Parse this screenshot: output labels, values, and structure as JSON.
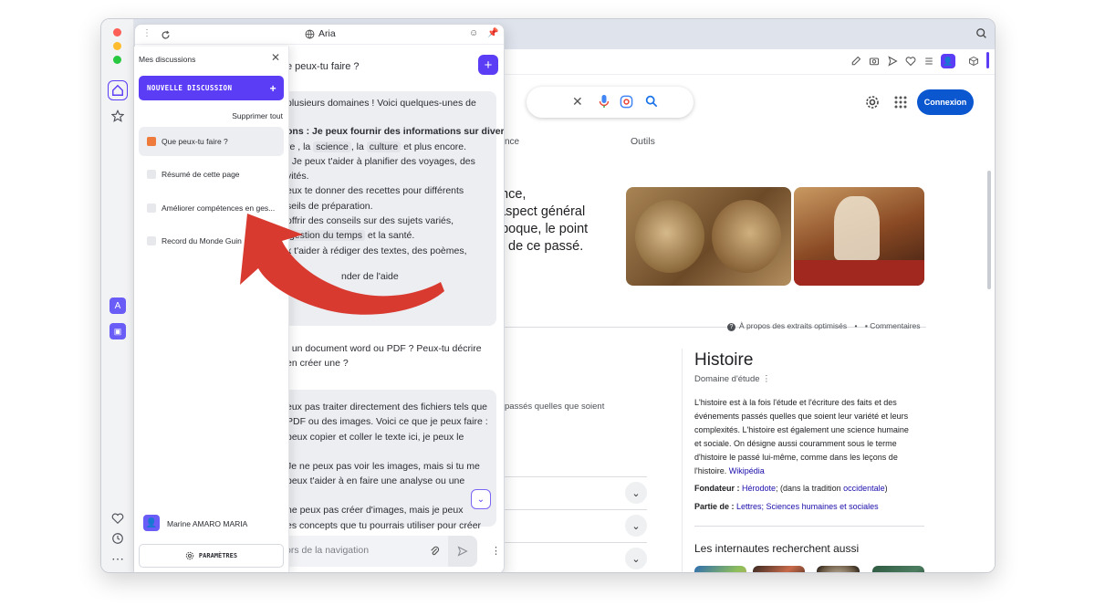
{
  "aria": {
    "title": "Aria",
    "question1": "e peux-tu faire ?",
    "answer1": {
      "lines": [
        "plusieurs domaines ! Voici quelques-unes de",
        "",
        "ons : Je peux fournir des informations sur divers",
        "re",
        ", la",
        "science",
        ", la",
        "culture",
        "et plus encore.",
        ": Je peux t'aider à planifier des voyages, des",
        "vités.",
        "eux te donner des recettes pour différents",
        "seils de préparation.",
        "offrir des conseils sur des sujets variés,",
        "gestion du temps",
        "et la santé.",
        "x t'aider à rédiger des textes, des poèmes,",
        "nder de l'aide"
      ]
    },
    "question2": [
      ", un document word ou PDF ? Peux-tu décrire",
      "en créer une ?"
    ],
    "answer2": [
      "eux pas traiter directement des fichiers tels que",
      "PDF ou des images. Voici ce que je peux faire :",
      "peux copier et coller le texte ici, je peux le",
      "Je ne peux pas voir les images, mais si tu me",
      "peux t'aider à en faire une analyse ou une",
      "ne peux pas créer d'images, mais je peux",
      "es concepts que tu pourrais utiliser pour créer"
    ],
    "input_placeholder": "ors de la navigation"
  },
  "discussions": {
    "title": "Mes discussions",
    "new_button": "NOUVELLE DISCUSSION",
    "delete_all": "Supprimer tout",
    "items": [
      {
        "label": "Que peux-tu faire ?"
      },
      {
        "label": "Résumé de cette page"
      },
      {
        "label": "Améliorer compétences en ges..."
      },
      {
        "label": "Record du Monde Guin"
      }
    ],
    "user": "Marine AMARO MARIA",
    "settings": "PARAMÈTRES"
  },
  "google": {
    "connexion": "Connexion",
    "tab_partial": "nce",
    "tab_outils": "Outils",
    "snippet_lines": [
      "nce,",
      "n aspect général",
      "époque, le point",
      "de ce passé."
    ],
    "about_snippets": "À propos des extraits optimisés",
    "comments": "Commentaires",
    "passes_text": "ts passés quelles que soient",
    "kg_title": "Histoire",
    "kg_subtitle": "Domaine d'étude",
    "kg_desc_lines": [
      "L'histoire est à la fois l'étude et l'écriture des faits et des",
      "événements passés quelles que soient leur variété et leurs",
      "complexités. L'histoire est également une science humaine",
      "et sociale. On désigne aussi couramment sous le terme",
      "d'histoire le passé lui-même, comme dans les leçons de",
      "l'histoire."
    ],
    "kg_wikipedia": "Wikipédia",
    "founder_label": "Fondateur :",
    "founder_value": "Hérodote",
    "founder_rest": "; (dans la tradition",
    "founder_link2": "occidentale",
    "founder_end": ")",
    "part_label": "Partie de :",
    "part_value": "Lettres; Sciences humaines et sociales",
    "also_searched": "Les internautes recherchent aussi"
  },
  "colors": {
    "accent": "#5b3df5",
    "google_blue": "#0b57d0",
    "arrow_red": "#d93a30"
  }
}
